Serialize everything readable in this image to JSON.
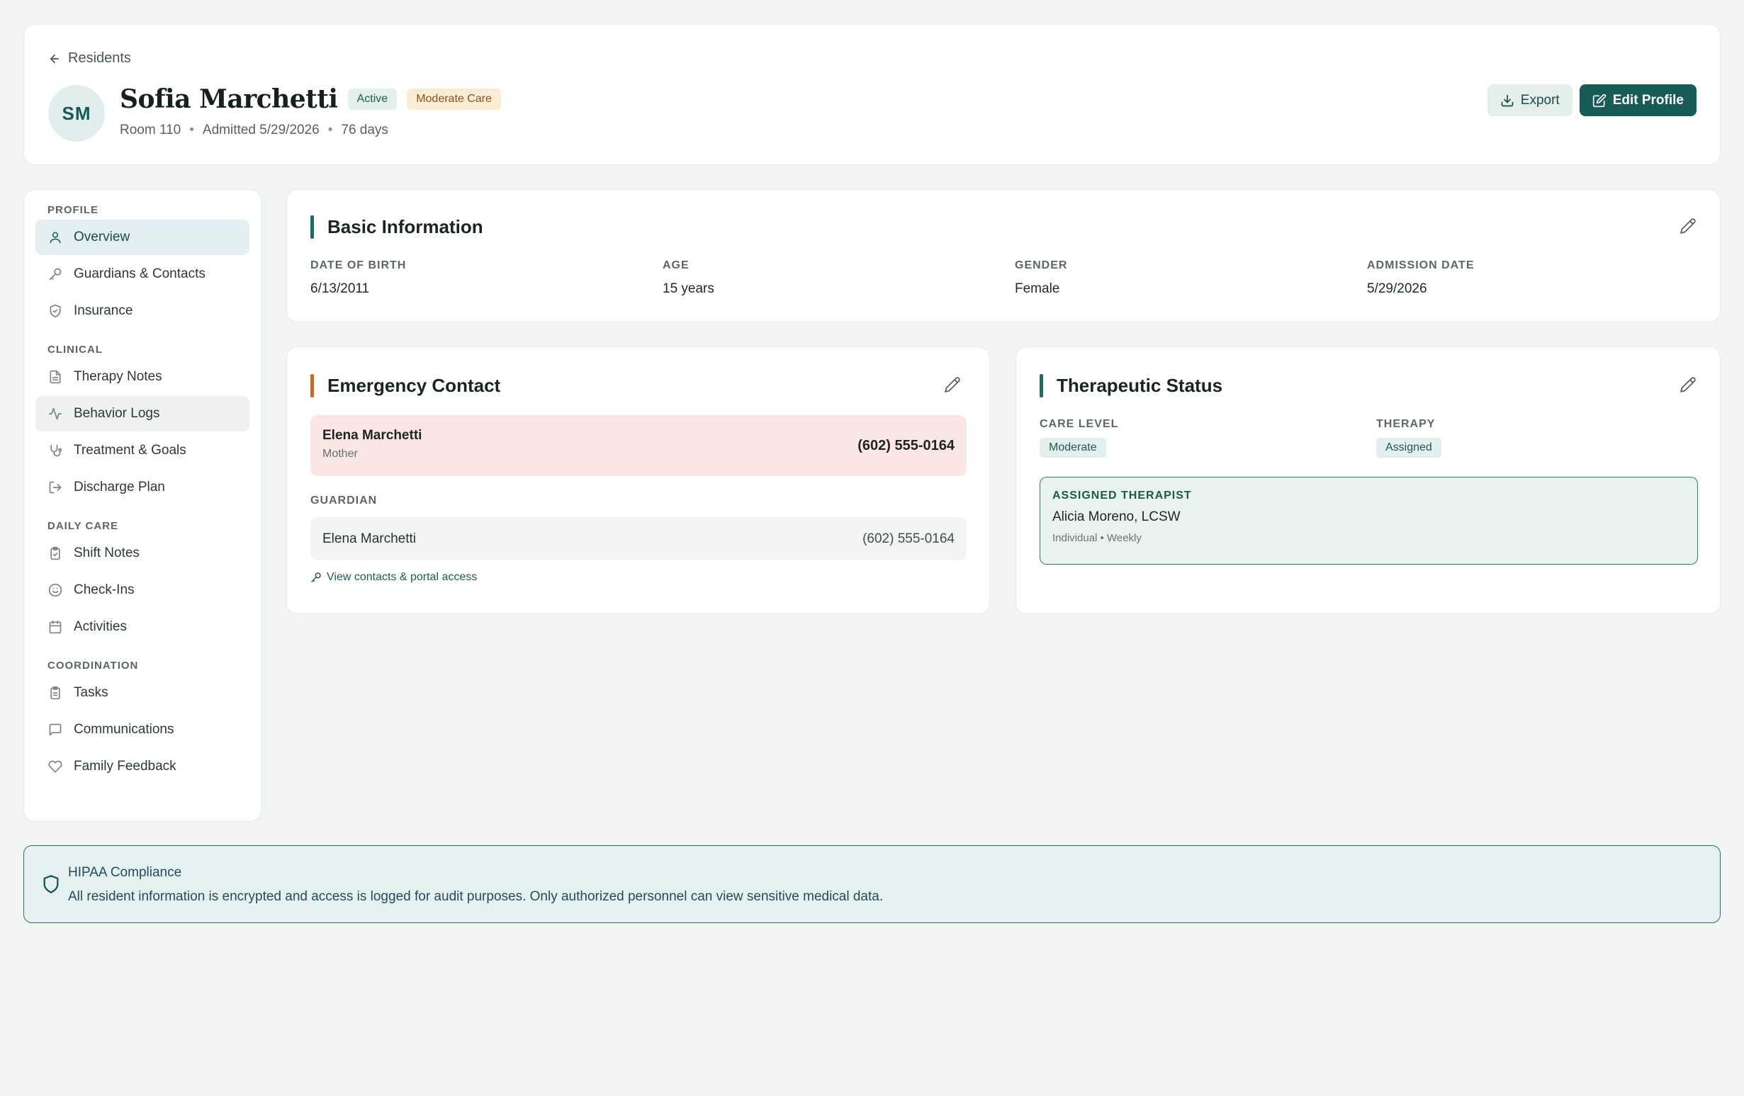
{
  "header": {
    "back_label": "Residents",
    "initials": "SM",
    "name": "Sofia Marchetti",
    "status_badge": "Active",
    "care_badge": "Moderate Care",
    "room": "Room 110",
    "admitted": "Admitted 5/29/2026",
    "days": "76 days",
    "export_label": "Export",
    "edit_label": "Edit Profile"
  },
  "sidebar": {
    "sections": [
      {
        "heading": "PROFILE",
        "items": [
          {
            "label": "Overview",
            "icon": "user-icon",
            "active": true
          },
          {
            "label": "Guardians & Contacts",
            "icon": "key-icon"
          },
          {
            "label": "Insurance",
            "icon": "shield-check-icon"
          }
        ]
      },
      {
        "heading": "CLINICAL",
        "items": [
          {
            "label": "Therapy Notes",
            "icon": "file-text-icon"
          },
          {
            "label": "Behavior Logs",
            "icon": "activity-icon",
            "hover": true
          },
          {
            "label": "Treatment & Goals",
            "icon": "stethoscope-icon"
          },
          {
            "label": "Discharge Plan",
            "icon": "log-out-icon"
          }
        ]
      },
      {
        "heading": "DAILY CARE",
        "items": [
          {
            "label": "Shift Notes",
            "icon": "clipboard-check-icon"
          },
          {
            "label": "Check-Ins",
            "icon": "smile-icon"
          },
          {
            "label": "Activities",
            "icon": "calendar-icon"
          }
        ]
      },
      {
        "heading": "COORDINATION",
        "items": [
          {
            "label": "Tasks",
            "icon": "clipboard-list-icon"
          },
          {
            "label": "Communications",
            "icon": "message-square-icon"
          },
          {
            "label": "Family Feedback",
            "icon": "heart-icon"
          }
        ]
      }
    ]
  },
  "basic_info": {
    "title": "Basic Information",
    "fields": [
      {
        "label": "DATE OF BIRTH",
        "value": "6/13/2011"
      },
      {
        "label": "AGE",
        "value": "15 years"
      },
      {
        "label": "GENDER",
        "value": "Female"
      },
      {
        "label": "ADMISSION DATE",
        "value": "5/29/2026"
      }
    ]
  },
  "emergency": {
    "title": "Emergency Contact",
    "contact_name": "Elena Marchetti",
    "contact_relation": "Mother",
    "contact_phone": "(602) 555-0164",
    "guardian_label": "GUARDIAN",
    "guardian_name": "Elena Marchetti",
    "guardian_phone": "(602) 555-0164",
    "link_label": "View contacts & portal access"
  },
  "therapeutic": {
    "title": "Therapeutic Status",
    "care_level_label": "CARE LEVEL",
    "care_level_value": "Moderate",
    "therapy_label": "THERAPY",
    "therapy_value": "Assigned",
    "therapist_label": "ASSIGNED THERAPIST",
    "therapist_name": "Alicia Moreno, LCSW",
    "therapist_details": "Individual • Weekly"
  },
  "hipaa": {
    "title": "HIPAA Compliance",
    "text": "All resident information is encrypted and access is logged for audit purposes. Only authorized personnel can view sensitive medical data."
  },
  "colors": {
    "brand": "#175b56",
    "accent_emergency": "#c8692a",
    "accent_teal": "#1d6b62"
  }
}
